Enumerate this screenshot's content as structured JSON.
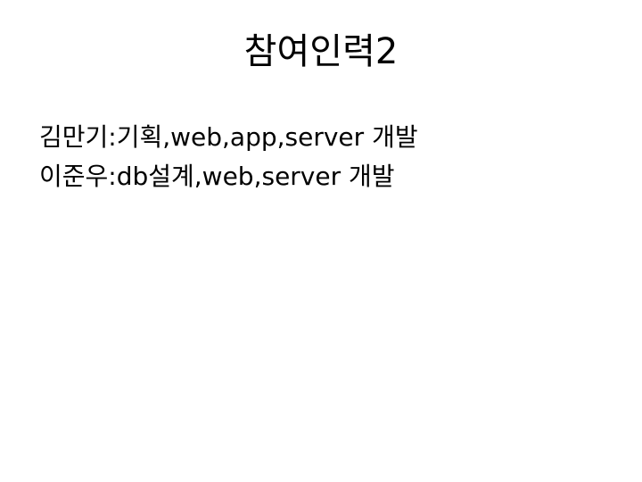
{
  "slide": {
    "title": "참여인력2",
    "lines": [
      "김만기:기획,web,app,server 개발",
      "이준우:db설계,web,server 개발"
    ]
  }
}
